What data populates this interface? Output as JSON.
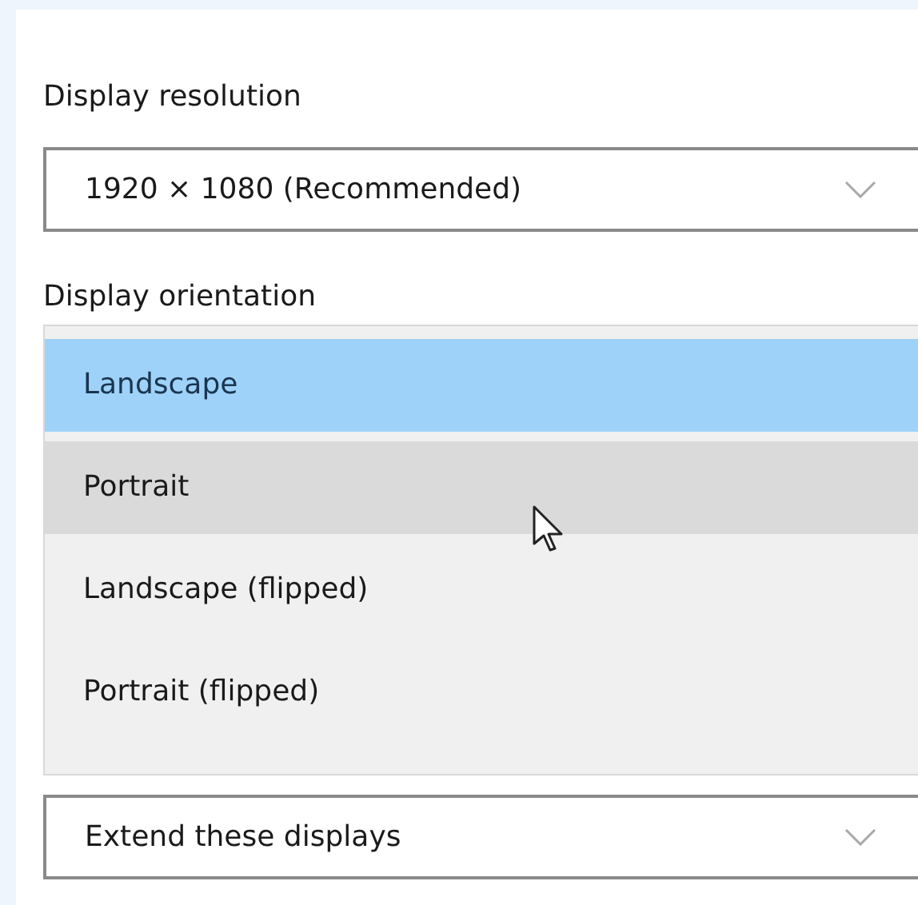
{
  "resolution": {
    "label": "Display resolution",
    "value": "1920 × 1080 (Recommended)"
  },
  "orientation": {
    "label": "Display orientation",
    "options": [
      {
        "label": "Landscape",
        "selected": true,
        "hovered": false
      },
      {
        "label": "Portrait",
        "selected": false,
        "hovered": true
      },
      {
        "label": "Landscape (flipped)",
        "selected": false,
        "hovered": false
      },
      {
        "label": "Portrait (flipped)",
        "selected": false,
        "hovered": false
      }
    ]
  },
  "multiple_displays": {
    "value": "Extend these displays"
  }
}
